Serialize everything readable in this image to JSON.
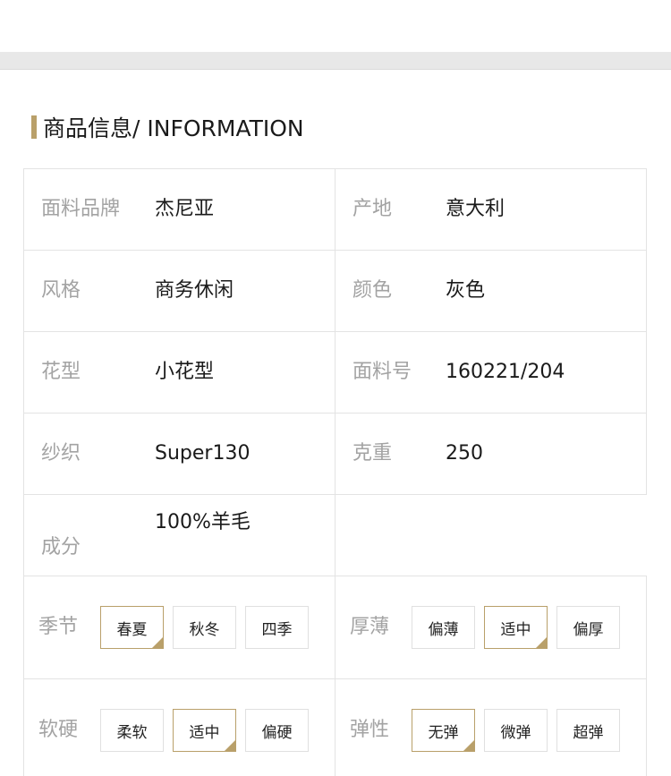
{
  "section": {
    "title": "商品信息/ INFORMATION"
  },
  "specs": [
    {
      "left": {
        "label": "面料品牌",
        "value": "杰尼亚"
      },
      "right": {
        "label": "产地",
        "value": "意大利"
      }
    },
    {
      "left": {
        "label": "风格",
        "value": "商务休闲"
      },
      "right": {
        "label": "颜色",
        "value": "灰色"
      }
    },
    {
      "left": {
        "label": "花型",
        "value": "小花型"
      },
      "right": {
        "label": "面料号",
        "value": "160221/204"
      }
    },
    {
      "left": {
        "label": "纱织",
        "value": "Super130"
      },
      "right": {
        "label": "克重",
        "value": "250"
      }
    },
    {
      "left": {
        "label": "成分",
        "value": "100%羊毛"
      }
    }
  ],
  "options": {
    "season": {
      "label": "季节",
      "items": [
        "春夏",
        "秋冬",
        "四季"
      ],
      "selected": "春夏"
    },
    "thickness": {
      "label": "厚薄",
      "items": [
        "偏薄",
        "适中",
        "偏厚"
      ],
      "selected": "适中"
    },
    "hardness": {
      "label": "软硬",
      "items": [
        "柔软",
        "适中",
        "偏硬"
      ],
      "selected": "适中"
    },
    "elasticity": {
      "label": "弹性",
      "items": [
        "无弹",
        "微弹",
        "超弹"
      ],
      "selected": "无弹"
    }
  },
  "colors": {
    "accent": "#b9a06a",
    "label": "#a3a3a3",
    "border": "#e3e3e3",
    "band": "#e8e8e8"
  }
}
